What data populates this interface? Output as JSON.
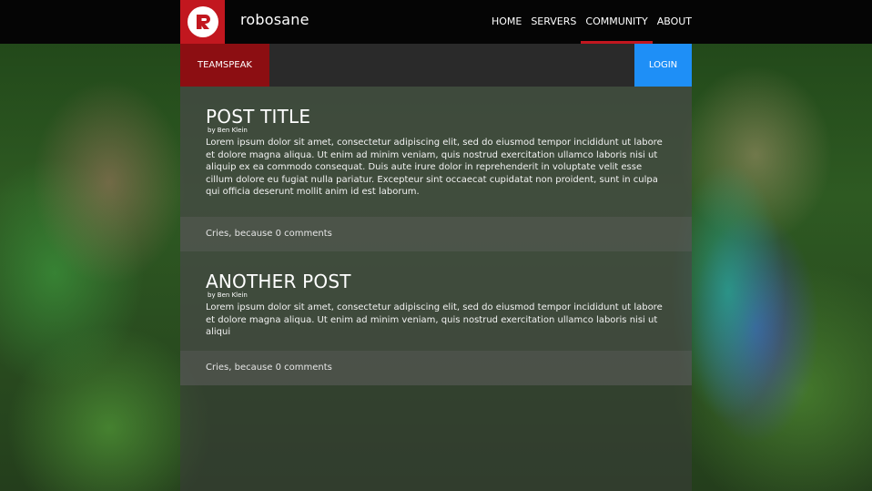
{
  "header": {
    "brand": "robosane",
    "logo_icon": "robosane-r-logo-icon",
    "accent_color": "#c2171f",
    "nav": [
      {
        "label": "HOME",
        "active": false
      },
      {
        "label": "SERVERS",
        "active": false
      },
      {
        "label": "COMMUNITY",
        "active": true
      },
      {
        "label": "ABOUT",
        "active": false
      }
    ]
  },
  "subbar": {
    "teamspeak_label": "TEAMSPEAK",
    "login_label": "LOGIN",
    "login_color": "#1e8ff7"
  },
  "posts": [
    {
      "title": "POST TITLE",
      "author": "by Ben Klein",
      "text": "Lorem ipsum dolor sit amet, consectetur adipiscing elit, sed do eiusmod tempor incididunt ut labore et dolore magna aliqua. Ut enim ad minim veniam, quis nostrud exercitation ullamco laboris nisi ut aliquip ex ea commodo consequat. Duis aute irure dolor in reprehenderit in voluptate velit esse cillum dolore eu fugiat nulla pariatur. Excepteur sint occaecat cupidatat non proident, sunt in culpa qui officia deserunt mollit anim id est laborum.",
      "footer": "Cries, because 0 comments"
    },
    {
      "title": "ANOTHER POST",
      "author": "by Ben Klein",
      "text": "Lorem ipsum dolor sit amet, consectetur adipiscing elit, sed do eiusmod tempor incididunt ut labore et dolore magna aliqua. Ut enim ad minim veniam, quis nostrud exercitation ullamco laboris nisi ut aliqui",
      "footer": "Cries, because 0 comments"
    }
  ]
}
